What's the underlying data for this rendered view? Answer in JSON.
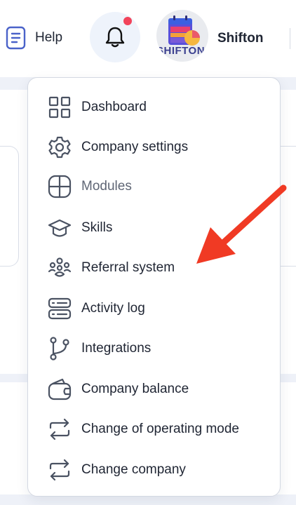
{
  "header": {
    "help_label": "Help",
    "company_name": "Shifton",
    "avatar_text": "SHIFTON",
    "notification_dot_color": "#f2435a"
  },
  "menu": {
    "items": [
      {
        "label": "Dashboard",
        "icon": "grid-icon"
      },
      {
        "label": "Company settings",
        "icon": "gear-icon"
      },
      {
        "label": "Modules",
        "icon": "modules-icon"
      },
      {
        "label": "Skills",
        "icon": "graduation-cap-icon"
      },
      {
        "label": "Referral system",
        "icon": "referral-icon"
      },
      {
        "label": "Activity log",
        "icon": "activity-log-icon"
      },
      {
        "label": "Integrations",
        "icon": "branch-icon"
      },
      {
        "label": "Company balance",
        "icon": "wallet-icon"
      },
      {
        "label": "Change of operating mode",
        "icon": "swap-icon"
      },
      {
        "label": "Change company",
        "icon": "swap-icon"
      }
    ]
  },
  "annotation": {
    "arrow_color": "#f03a24"
  }
}
